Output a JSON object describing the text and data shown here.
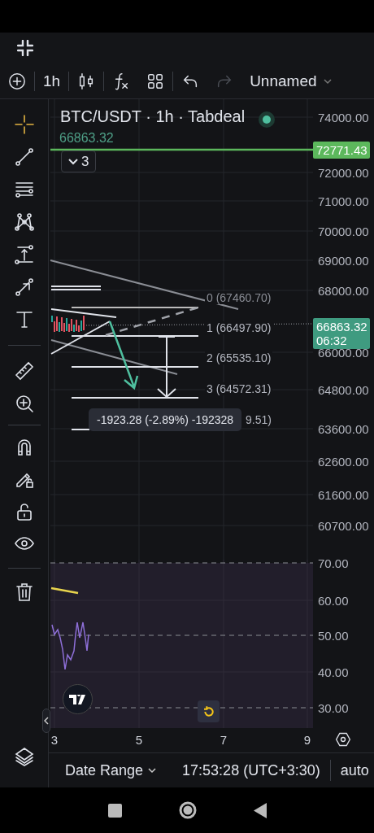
{
  "toolbar": {
    "interval": "1h",
    "redo": {
      "disabled": true
    },
    "layout_name": "Unnamed"
  },
  "tool_groups": [
    [
      {
        "kind": "crosshair",
        "selected": true
      },
      {
        "kind": "trend-line",
        "selected": false
      },
      {
        "kind": "parallel-lines",
        "selected": false
      },
      {
        "kind": "pattern",
        "selected": false
      },
      {
        "kind": "projection",
        "selected": false
      },
      {
        "kind": "arrow",
        "selected": false
      },
      {
        "kind": "text",
        "selected": false
      }
    ],
    [
      {
        "kind": "ruler",
        "selected": false
      },
      {
        "kind": "zoom",
        "selected": false
      }
    ],
    [
      {
        "kind": "magnet",
        "selected": false
      },
      {
        "kind": "draw-lock",
        "selected": false
      },
      {
        "kind": "lock",
        "selected": false
      },
      {
        "kind": "eye",
        "selected": false
      }
    ],
    [
      {
        "kind": "trash",
        "selected": false
      }
    ]
  ],
  "chart": {
    "title": "BTC/USDT · 1h · Tabdeal",
    "last_price": "66863.32",
    "indicator_count": "3",
    "price_axis": [
      "74000.00",
      "72000.00",
      "71000.00",
      "70000.00",
      "69000.00",
      "68000.00",
      "66000.00",
      "64800.00",
      "63600.00",
      "62600.00",
      "61600.00",
      "60700.00"
    ],
    "line_tag": "72771.43",
    "price_tag": {
      "price": "66863.32",
      "countdown": "06:32"
    },
    "fib_labels": [
      "0 (67460.70)",
      "1 (66497.90)",
      "2 (65535.10)",
      "3 (64572.31)",
      "9.51)"
    ],
    "measure_tooltip": "-1923.28 (-2.89%) -192328"
  },
  "rsi": {
    "axis": [
      "70.00",
      "60.00",
      "50.00",
      "40.00",
      "30.00"
    ]
  },
  "time_axis": [
    "3",
    "5",
    "7",
    "9"
  ],
  "bottom_bar": {
    "date_range": "Date Range",
    "time": "17:53:28 (UTC+3:30)",
    "scale": "auto"
  }
}
